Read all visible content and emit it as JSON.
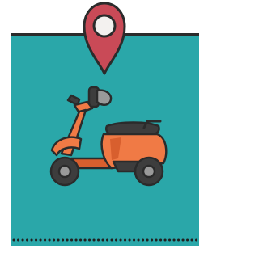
{
  "colors": {
    "card": "#2aa7a9",
    "card_shadow": "#1f8d90",
    "outline": "#2b2b2b",
    "pin": "#c94a57",
    "pin_inner": "#f3f1ef",
    "scooter_body": "#f07a45",
    "scooter_shade": "#d85f2e",
    "seat": "#3d3d3d",
    "wheel": "#3d3d3d",
    "hub": "#9a9a9a",
    "dots": "#1f1f1f"
  },
  "icons": {
    "pin": "map-pin-icon",
    "vehicle": "scooter-icon"
  }
}
